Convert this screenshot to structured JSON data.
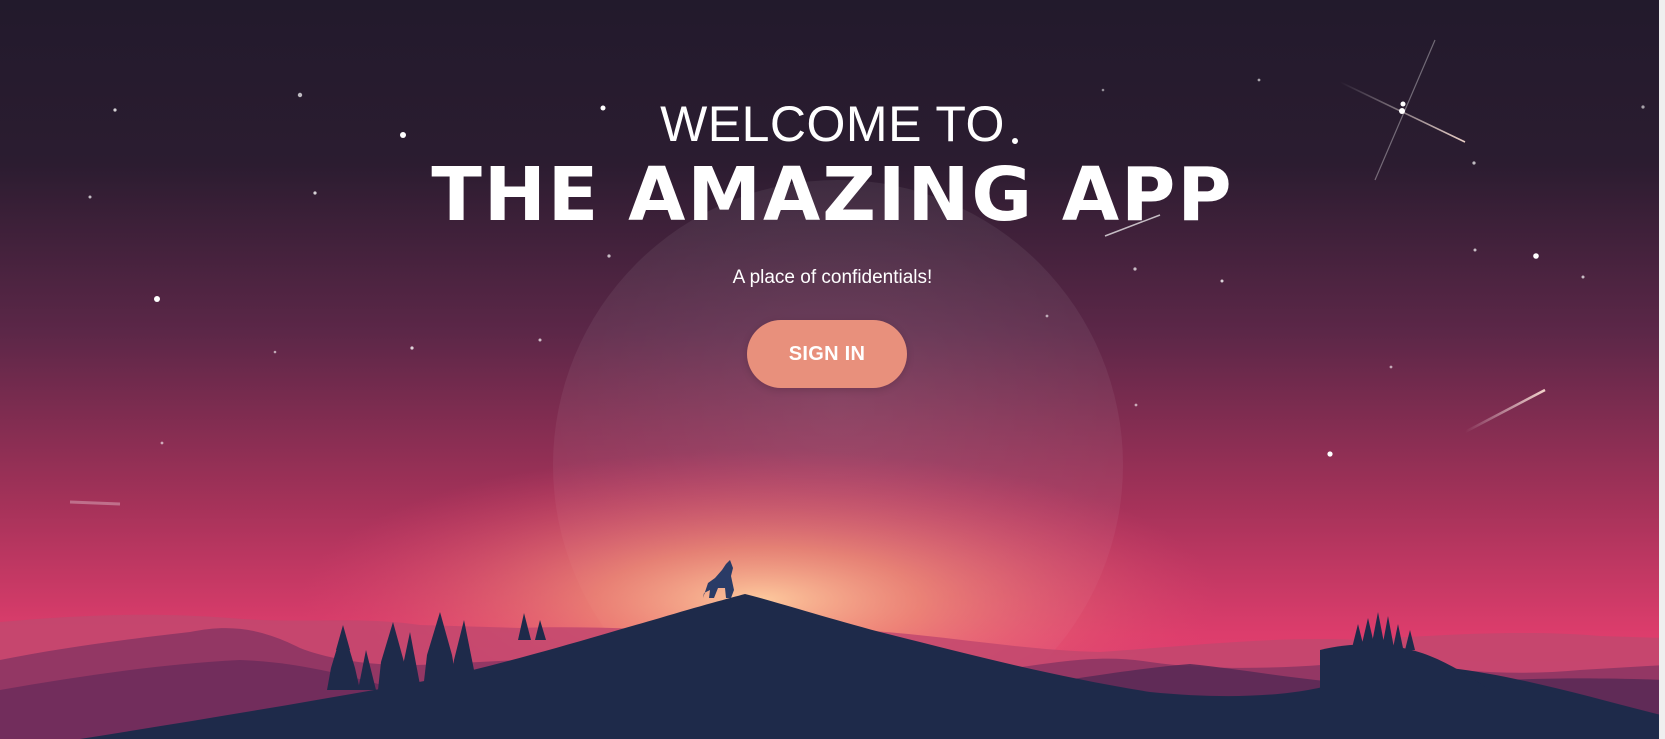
{
  "hero": {
    "welcome": "WELCOME TO",
    "title": "THE AMAZING APP",
    "tagline": "A place of confidentials!",
    "signin_label": "SIGN IN"
  },
  "colors": {
    "sky_top": "#221a2c",
    "sky_mid": "#5a2645",
    "sky_low": "#c2375f",
    "horizon_glow": "#f5a57a",
    "mountain_front": "#1e2a4a",
    "button": "#e8907c"
  }
}
